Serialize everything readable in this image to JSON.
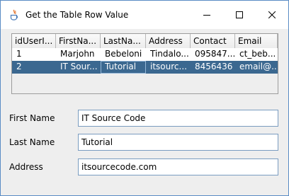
{
  "window": {
    "title": "Get the Table Row Value"
  },
  "table": {
    "columns": [
      "idUserI...",
      "FirstNa...",
      "LastNa...",
      "Address",
      "Contact",
      "Email"
    ],
    "rows": [
      [
        "1",
        "Marjohn",
        "Bebeloni",
        "Tindalo...",
        "095847...",
        "ct_beb..."
      ],
      [
        "2",
        "IT Sour...",
        "Tutorial",
        "itsourc...",
        "8456436",
        "email@..."
      ]
    ],
    "selected_row": 2
  },
  "form": {
    "first_name_label": "First Name",
    "first_name_value": "IT Source Code",
    "last_name_label": "Last Name",
    "last_name_value": "Tutorial",
    "address_label": "Address",
    "address_value": "itsourcecode.com"
  },
  "icons": [
    "java-app-icon",
    "minimize-icon",
    "maximize-icon",
    "close-icon"
  ],
  "colors": {
    "selection": "#3b6890",
    "field_border": "#7a9cc0",
    "window_border": "#5a8cc4"
  }
}
